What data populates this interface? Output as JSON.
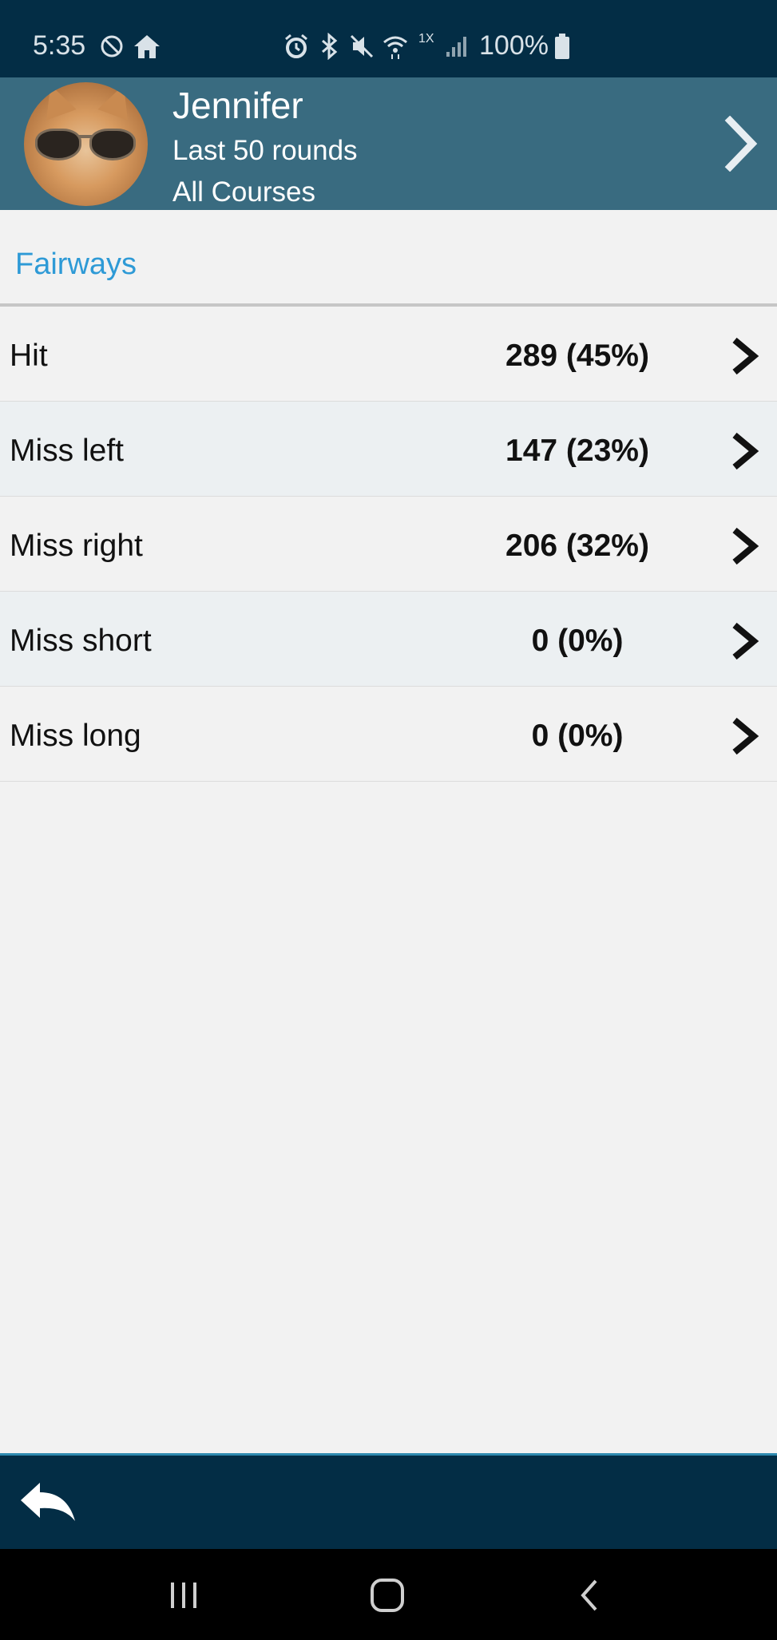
{
  "status_bar": {
    "time": "5:35",
    "battery_percent": "100%",
    "signal_label": "1X",
    "icons": [
      "alarm-icon",
      "bluetooth-icon",
      "mute-icon",
      "wifi-icon",
      "signal-icon",
      "battery-icon",
      "do-not-disturb-icon",
      "home-icon"
    ]
  },
  "profile": {
    "name": "Jennifer",
    "rounds": "Last 50 rounds",
    "courses": "All Courses"
  },
  "section": {
    "title": "Fairways"
  },
  "stats": [
    {
      "label": "Hit",
      "value": "289 (45%)"
    },
    {
      "label": "Miss left",
      "value": "147 (23%)"
    },
    {
      "label": "Miss right",
      "value": "206 (32%)"
    },
    {
      "label": "Miss short",
      "value": "0 (0%)"
    },
    {
      "label": "Miss long",
      "value": "0 (0%)"
    }
  ],
  "colors": {
    "status_bar": "#032d45",
    "header": "#396b80",
    "accent": "#2e9ad6",
    "background": "#f2f2f2"
  }
}
